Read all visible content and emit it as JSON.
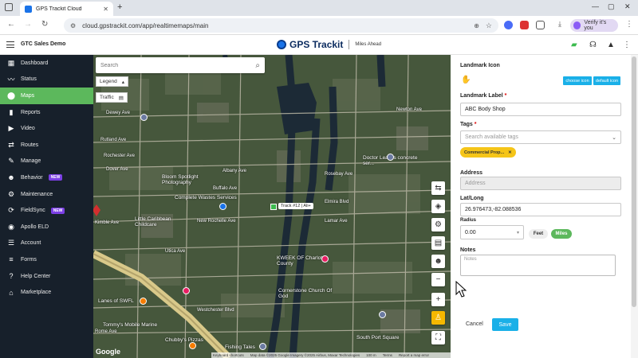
{
  "browser": {
    "tab_title": "GPS Trackit Cloud",
    "url": "cloud.gpstrackit.com/app/realtimemaps/main",
    "profile_label": "Verify it's you"
  },
  "header": {
    "company": "GTC Sales Demo",
    "logo_text": "GPS Trackit",
    "tagline": "Miles Ahead"
  },
  "sidebar": {
    "items": [
      {
        "label": "Dashboard",
        "icon": "dashboard-icon",
        "glyph": "▦",
        "badge": ""
      },
      {
        "label": "Status",
        "icon": "status-icon",
        "glyph": "〰",
        "badge": ""
      },
      {
        "label": "Maps",
        "icon": "map-pin-icon",
        "glyph": "⬤",
        "badge": "",
        "active": true
      },
      {
        "label": "Reports",
        "icon": "reports-icon",
        "glyph": "▮",
        "badge": ""
      },
      {
        "label": "Video",
        "icon": "video-icon",
        "glyph": "▶",
        "badge": ""
      },
      {
        "label": "Routes",
        "icon": "routes-icon",
        "glyph": "⇄",
        "badge": ""
      },
      {
        "label": "Manage",
        "icon": "wrench-icon",
        "glyph": "✎",
        "badge": ""
      },
      {
        "label": "Behavior",
        "icon": "behavior-icon",
        "glyph": "☻",
        "badge": "NEW"
      },
      {
        "label": "Maintenance",
        "icon": "maintenance-icon",
        "glyph": "⚙",
        "badge": ""
      },
      {
        "label": "FieldSync",
        "icon": "fieldsync-icon",
        "glyph": "⟳",
        "badge": "NEW"
      },
      {
        "label": "Apollo ELD",
        "icon": "eld-icon",
        "glyph": "◉",
        "badge": ""
      },
      {
        "label": "Account",
        "icon": "account-icon",
        "glyph": "☰",
        "badge": ""
      },
      {
        "label": "Forms",
        "icon": "forms-icon",
        "glyph": "≡",
        "badge": ""
      },
      {
        "label": "Help Center",
        "icon": "help-icon",
        "glyph": "?",
        "badge": ""
      },
      {
        "label": "Marketplace",
        "icon": "marketplace-icon",
        "glyph": "⌂",
        "badge": ""
      }
    ]
  },
  "map": {
    "search_placeholder": "Search",
    "legend_label": "Legend",
    "traffic_label": "Traffic",
    "vehicle_label": "Track #12 | Ali+",
    "streets": [
      "Dewey Ave",
      "Rutland Ave",
      "Rochester Ave",
      "Dover Ave",
      "Buffalo Ave",
      "Albany Ave",
      "Rosebay Ave",
      "Elmira Blvd",
      "New Rochelle Ave",
      "Lamar Ave",
      "Utica Ave",
      "Newton Ave",
      "Kimble Ave",
      "Westchester Blvd",
      "Rome Ave"
    ],
    "pois": [
      "Bloom Spotlight Photography",
      "Complete Wastes Services",
      "Little Caribbean Childcare",
      "Doctor Leath's concrete ser...",
      "KWEEK OF Charlotte County",
      "Cornerstone Church Of God",
      "Lanes of SWFL",
      "Tommy's Mobile Marine",
      "Chubby's Pizzas",
      "South Port Square",
      "Fishing Tales"
    ],
    "attribution": [
      "Keyboard shortcuts",
      "Map data ©2025 Google Imagery ©2025 Airbus, Maxar Technologies",
      "100 m",
      "Terms",
      "Report a map error"
    ],
    "google_text": "Google"
  },
  "panel": {
    "landmark_icon_label": "Landmark Icon",
    "choose_icon": "choose icon",
    "default_icon": "default icon",
    "landmark_label_label": "Landmark Label",
    "landmark_label_value": "ABC Body Shop",
    "tags_label": "Tags",
    "tags_placeholder": "Search available tags",
    "tag_chip": "Commercial Prop...",
    "address_label": "Address",
    "address_placeholder": "Address",
    "latlong_label": "Lat/Long",
    "latlong_value": "26.976473,-82.088536",
    "radius_label": "Radius",
    "radius_value": "0.00",
    "unit_feet": "Feet",
    "unit_miles": "Miles",
    "notes_label": "Notes",
    "notes_placeholder": "Notes",
    "cancel": "Cancel",
    "save": "Save"
  },
  "colors": {
    "sidebar_bg": "#17202b",
    "active_nav": "#5cb85c",
    "accent_blue": "#1ab0e8",
    "tag_yellow": "#f5c518",
    "new_badge": "#7b3fe4"
  }
}
